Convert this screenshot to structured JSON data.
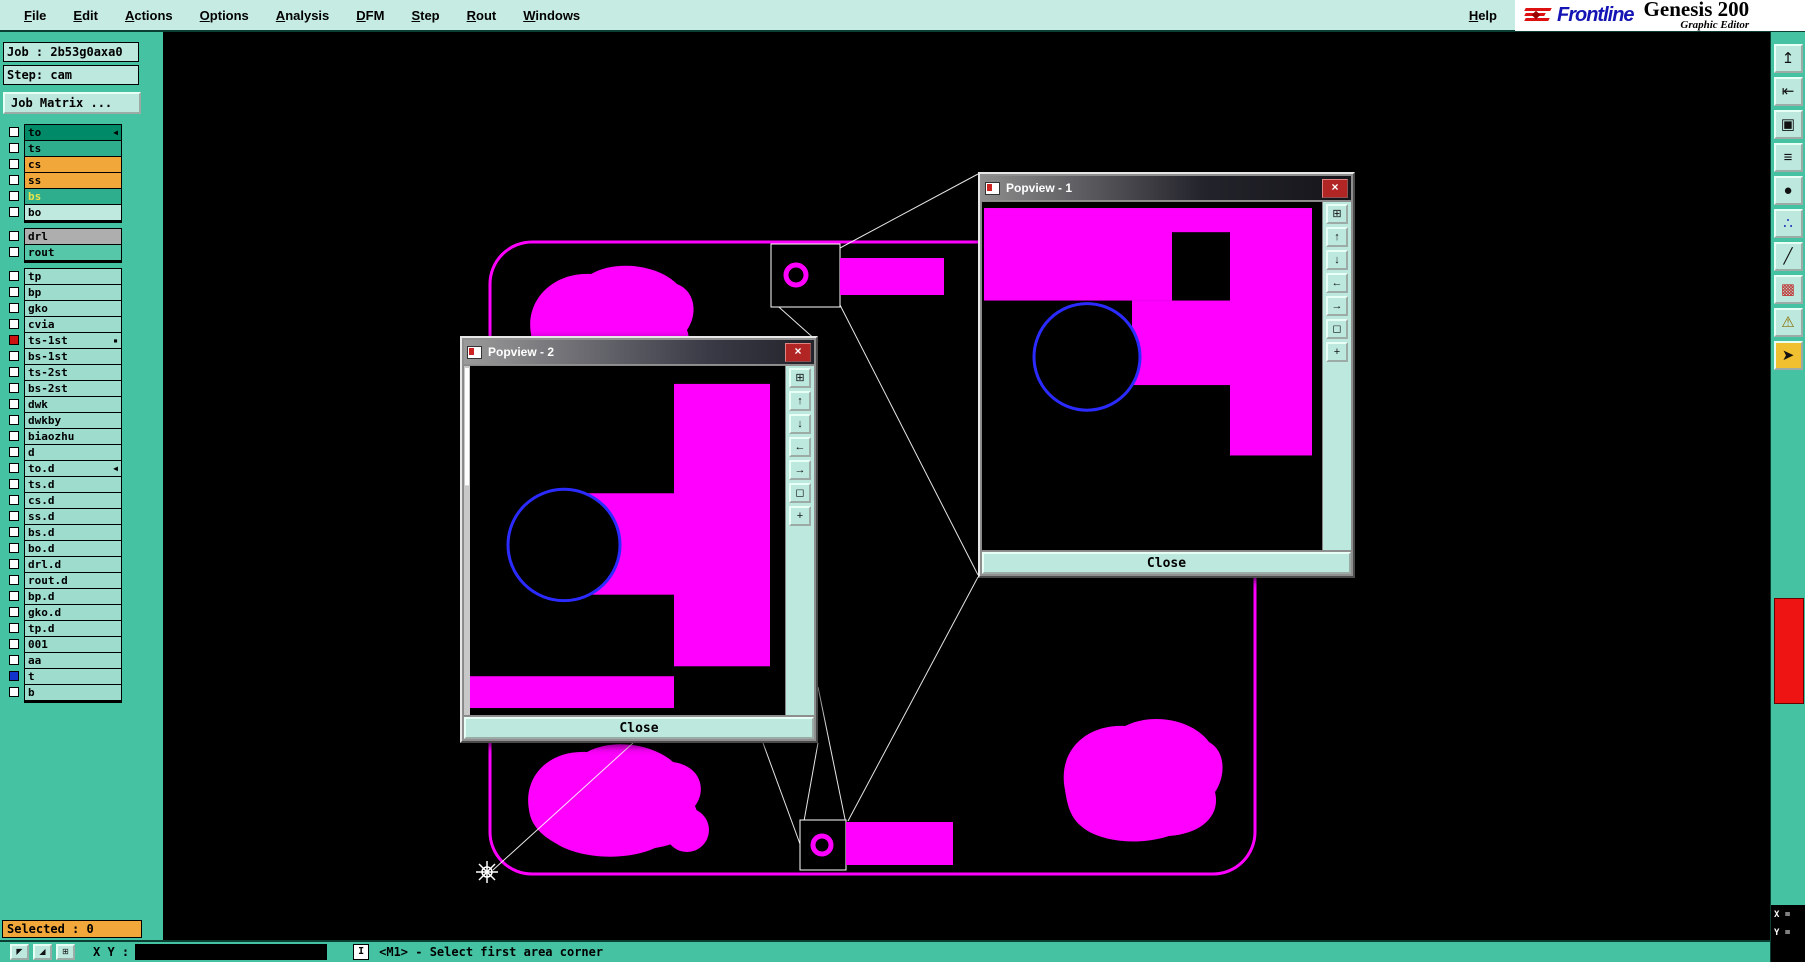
{
  "app": {
    "brand": "Frontline",
    "product": "Genesis 200",
    "subtitle": "Graphic Editor"
  },
  "menu": {
    "items": [
      "File",
      "Edit",
      "Actions",
      "Options",
      "Analysis",
      "DFM",
      "Step",
      "Rout",
      "Windows"
    ],
    "help": "Help"
  },
  "sidebar": {
    "job": "Job : 2b53g0axa0",
    "step": "Step: cam",
    "job_matrix": "Job Matrix ...",
    "selected": "Selected : 0",
    "layer_groups": [
      {
        "rows": [
          {
            "label": "to",
            "bg": "#008a68",
            "marker": "◀"
          },
          {
            "label": "ts",
            "bg": "#2fae8e"
          },
          {
            "label": "cs",
            "bg": "#f2a73b"
          },
          {
            "label": "ss",
            "bg": "#f2a73b"
          },
          {
            "label": "bs",
            "bg": "#2fae8e",
            "fg": "#e8e44a"
          },
          {
            "label": "bo",
            "bg": "#bfe9df"
          }
        ]
      },
      {
        "rows": [
          {
            "label": "drl",
            "bg": "#aeaeae"
          },
          {
            "label": "rout",
            "bg": "#57c7a9"
          }
        ]
      },
      {
        "rows": [
          {
            "label": "tp"
          },
          {
            "label": "bp"
          },
          {
            "label": "gko"
          },
          {
            "label": "cvia"
          },
          {
            "label": "ts-1st",
            "checkbox": "#cc1111",
            "marker": "▪"
          },
          {
            "label": "bs-1st"
          },
          {
            "label": "ts-2st"
          },
          {
            "label": "bs-2st"
          },
          {
            "label": "dwk"
          },
          {
            "label": "dwkby"
          },
          {
            "label": "biaozhu"
          },
          {
            "label": "d"
          },
          {
            "label": "to.d",
            "marker": "◀"
          },
          {
            "label": "ts.d"
          },
          {
            "label": "cs.d"
          },
          {
            "label": "ss.d"
          },
          {
            "label": "bs.d"
          },
          {
            "label": "bo.d"
          },
          {
            "label": "drl.d"
          },
          {
            "label": "rout.d"
          },
          {
            "label": "bp.d"
          },
          {
            "label": "gko.d"
          },
          {
            "label": "tp.d"
          },
          {
            "label": "001"
          },
          {
            "label": "aa"
          },
          {
            "label": "t",
            "checkbox": "#1133cc"
          },
          {
            "label": "b"
          }
        ]
      }
    ]
  },
  "popviews": [
    {
      "title": "Popview - 1",
      "close": "Close",
      "close_icon": "×"
    },
    {
      "title": "Popview - 2",
      "close": "Close",
      "close_icon": "×"
    }
  ],
  "popview_tools": [
    {
      "name": "new-view-icon",
      "glyph": "⊞"
    },
    {
      "name": "pan-up-icon",
      "glyph": "↑"
    },
    {
      "name": "pan-down-icon",
      "glyph": "↓"
    },
    {
      "name": "pan-left-icon",
      "glyph": "←"
    },
    {
      "name": "pan-right-icon",
      "glyph": "→"
    },
    {
      "name": "zoom-extents-icon",
      "glyph": "◻"
    },
    {
      "name": "crosshair-icon",
      "glyph": "+"
    }
  ],
  "right_toolbar": {
    "buttons": [
      {
        "name": "zoom-origin-icon",
        "glyph": "↥"
      },
      {
        "name": "pan-left-icon",
        "glyph": "⇤"
      },
      {
        "name": "copy-view-icon",
        "glyph": "▣"
      },
      {
        "name": "layers-icon",
        "glyph": "≡"
      },
      {
        "name": "pad-icon",
        "glyph": "●"
      },
      {
        "name": "points-icon",
        "glyph": "∴",
        "fg": "#2233bb"
      },
      {
        "name": "line-icon",
        "glyph": "╱"
      },
      {
        "name": "fill-grid-icon",
        "glyph": "▩",
        "fg": "#c03030"
      },
      {
        "name": "warning-icon",
        "glyph": "⚠",
        "fg": "#8a6d00"
      },
      {
        "name": "select-arrow-icon",
        "glyph": "➤",
        "bg": "#f0c030"
      }
    ],
    "x_label": "X =",
    "y_label": "Y ="
  },
  "statusbar": {
    "tools": [
      {
        "name": "corner-select-icon",
        "glyph": "◤"
      },
      {
        "name": "measure-icon",
        "glyph": "◢"
      },
      {
        "name": "grid-snap-icon",
        "glyph": "⊞"
      }
    ],
    "xy_label": "X Y :",
    "xy_value": "",
    "mode_glyph": "I",
    "hint": "<M1> - Select first area corner"
  },
  "colors": {
    "magenta": "#ff00ff",
    "teal": "#44c2a2",
    "panel": "#bde8de",
    "accent_blue": "#2b2bff"
  }
}
